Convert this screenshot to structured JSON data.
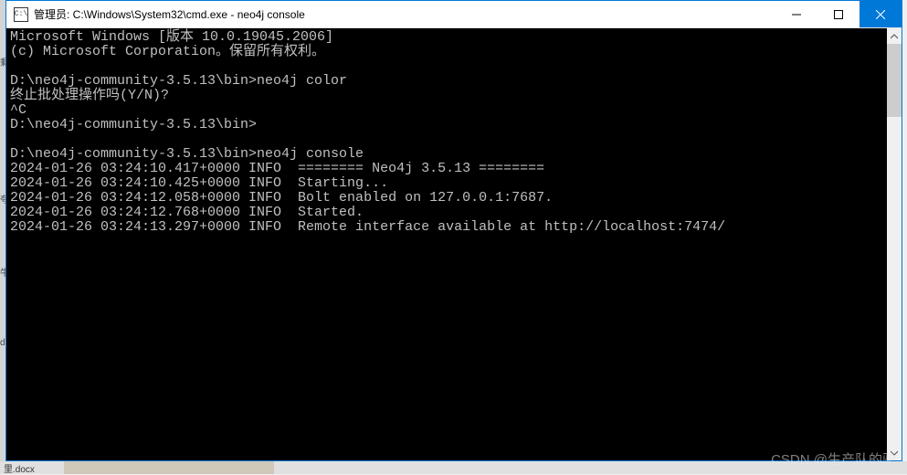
{
  "window": {
    "title": "管理员: C:\\Windows\\System32\\cmd.exe - neo4j  console",
    "icon_label": "C:\\"
  },
  "terminal": {
    "lines": [
      "Microsoft Windows [版本 10.0.19045.2006]",
      "(c) Microsoft Corporation。保留所有权利。",
      "",
      "D:\\neo4j-community-3.5.13\\bin>neo4j color",
      "终止批处理操作吗(Y/N)?",
      "^C",
      "D:\\neo4j-community-3.5.13\\bin>",
      "",
      "D:\\neo4j-community-3.5.13\\bin>neo4j console",
      "2024-01-26 03:24:10.417+0000 INFO  ======== Neo4j 3.5.13 ========",
      "2024-01-26 03:24:10.425+0000 INFO  Starting...",
      "2024-01-26 03:24:12.058+0000 INFO  Bolt enabled on 127.0.0.1:7687.",
      "2024-01-26 03:24:12.768+0000 INFO  Started.",
      "2024-01-26 03:24:13.297+0000 INFO  Remote interface available at http://localhost:7474/"
    ]
  },
  "left_edge_fragments": {
    "f1": "剩",
    "f2": "夸",
    "f3": "牛",
    "f4": "d"
  },
  "taskbar": {
    "fragment": "里.docx"
  },
  "watermark": "CSDN @生产队的驴"
}
